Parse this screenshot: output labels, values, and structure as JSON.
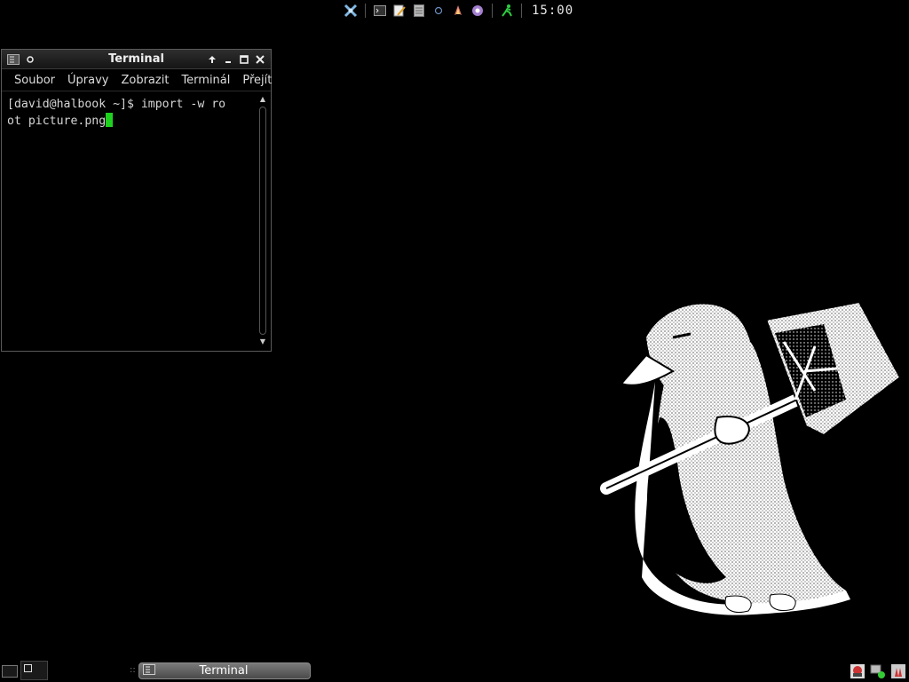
{
  "top_panel": {
    "clock": "15:00",
    "launchers": [
      {
        "icon": "xfce-menu-icon"
      },
      {
        "icon": "terminal-launcher-icon"
      },
      {
        "icon": "text-editor-icon"
      },
      {
        "icon": "file-manager-icon"
      },
      {
        "icon": "circle-icon"
      },
      {
        "icon": "rocket-icon"
      },
      {
        "icon": "settings-icon"
      },
      {
        "icon": "running-man-icon"
      }
    ]
  },
  "terminal_window": {
    "title": "Terminal",
    "menu": [
      "Soubor",
      "Úpravy",
      "Zobrazit",
      "Terminál",
      "Přejít"
    ],
    "prompt_line1": "[david@halbook ~]$ import -w ro",
    "prompt_line2": "ot picture.png",
    "cursor_color": "#1fd11f"
  },
  "bottom_panel": {
    "tasks": [
      {
        "label": "Terminal"
      }
    ],
    "tray": [
      {
        "icon": "printer-icon"
      },
      {
        "icon": "network-icon"
      },
      {
        "icon": "rocket-tray-icon"
      }
    ]
  },
  "wallpaper": {
    "icon": "penguin-with-hammer-icon"
  }
}
